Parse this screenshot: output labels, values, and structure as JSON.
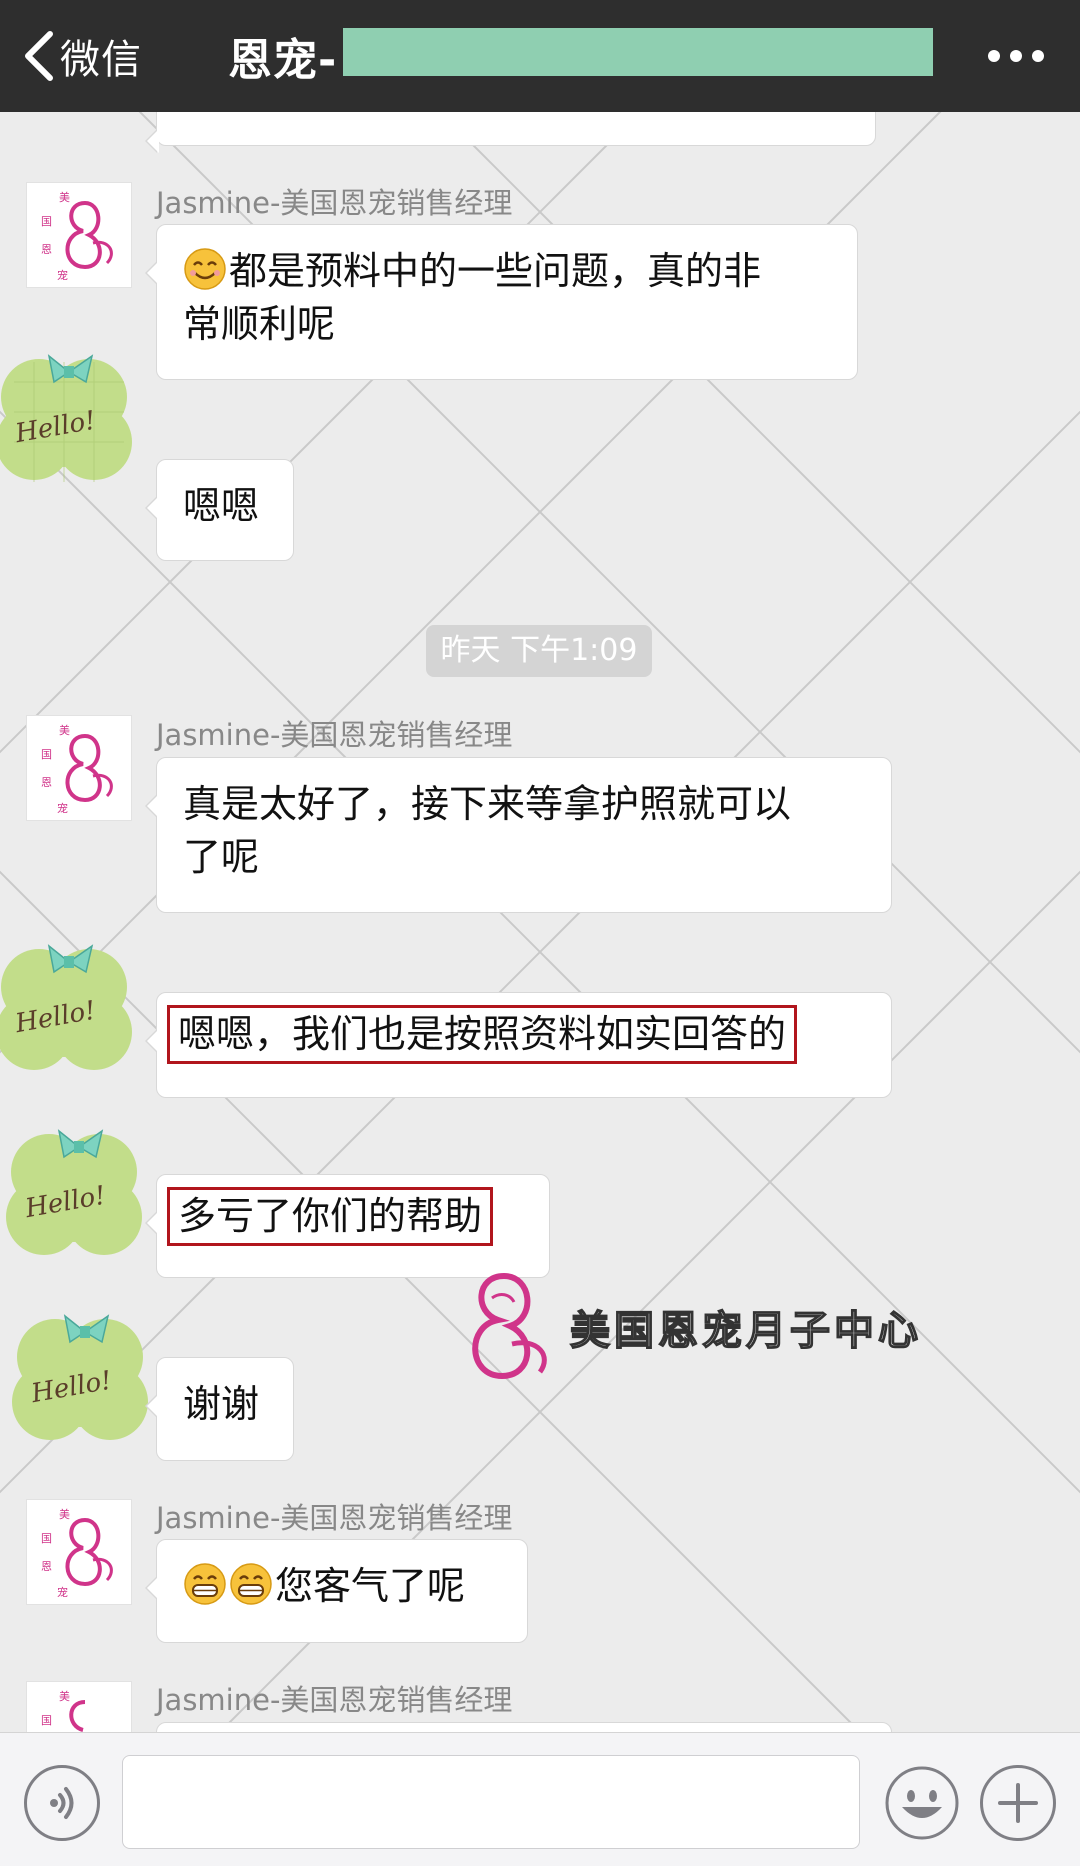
{
  "header": {
    "back_label": "微信",
    "title": "恩宠-",
    "redaction_color": "#8fcfb1",
    "icons": {
      "back": "chevron-left-icon",
      "more": "more-dots-icon"
    }
  },
  "messages": [
    {
      "sender": "Jasmine-美国恩宠销售经理",
      "text": "都是预料中的一些问题，真的非常顺利呢",
      "line1": "都是预料中的一些问题，真的非",
      "line2": "常顺利呢",
      "emoji": "smile"
    },
    {
      "sender": "",
      "text": "嗯嗯"
    },
    {
      "timestamp": "昨天 下午1:09"
    },
    {
      "sender": "Jasmine-美国恩宠销售经理",
      "line1": "真是太好了，接下来等拿护照就可以",
      "line2": "了呢"
    },
    {
      "sender": "",
      "text": "嗯嗯，我们也是按照资料如实回答的",
      "highlighted": true
    },
    {
      "sender": "",
      "text": "多亏了你们的帮助",
      "highlighted": true
    },
    {
      "sender": "",
      "text": "谢谢"
    },
    {
      "sender": "Jasmine-美国恩宠销售经理",
      "text": "您客气了呢",
      "emoji": "grin"
    },
    {
      "sender": "Jasmine-美国恩宠销售经理",
      "text": ""
    }
  ],
  "avatars": {
    "logo_chars": [
      "美",
      "国",
      "恩",
      "宠"
    ],
    "hello_text": "Hello!"
  },
  "watermark": {
    "text": "美国恩宠月子中心"
  },
  "colors": {
    "highlight_border": "#b1151d",
    "logo_pink": "#d0348a",
    "hello_green": "#c2dd8a",
    "ribbon": "#7dd3c0"
  },
  "input_bar": {
    "icons": {
      "voice": "voice-icon",
      "emoji": "emoji-icon",
      "plus": "plus-icon"
    }
  }
}
